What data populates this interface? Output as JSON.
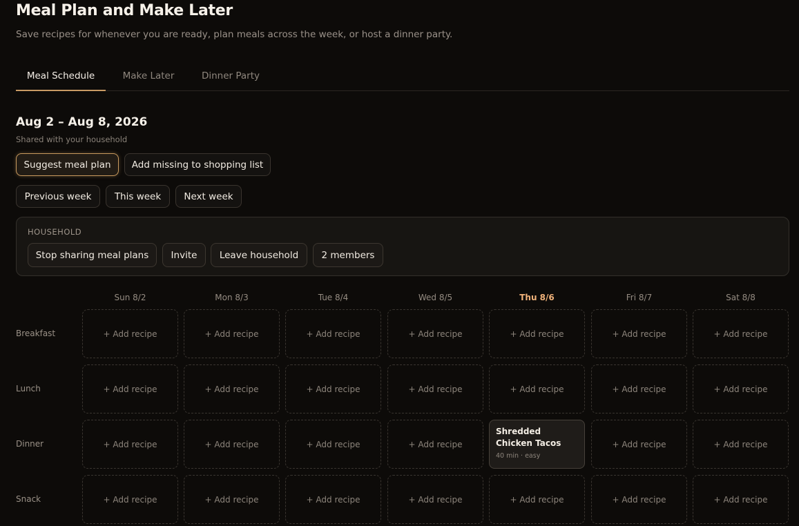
{
  "header": {
    "title": "Meal Plan and Make Later",
    "subtitle": "Save recipes for whenever you are ready, plan meals across the week, or host a dinner party."
  },
  "tabs": [
    {
      "label": "Meal Schedule",
      "active": true
    },
    {
      "label": "Make Later",
      "active": false
    },
    {
      "label": "Dinner Party",
      "active": false
    }
  ],
  "week": {
    "range": "Aug 2 – Aug 8, 2026",
    "shared_note": "Shared with your household"
  },
  "actions": {
    "suggest": "Suggest meal plan",
    "add_missing": "Add missing to shopping list",
    "previous": "Previous week",
    "this_week": "This week",
    "next": "Next week"
  },
  "household": {
    "label": "HOUSEHOLD",
    "stop_sharing": "Stop sharing meal plans",
    "invite": "Invite",
    "leave": "Leave household",
    "members": "2 members"
  },
  "days": [
    {
      "label": "Sun 8/2",
      "today": false
    },
    {
      "label": "Mon 8/3",
      "today": false
    },
    {
      "label": "Tue 8/4",
      "today": false
    },
    {
      "label": "Wed 8/5",
      "today": false
    },
    {
      "label": "Thu 8/6",
      "today": true
    },
    {
      "label": "Fri 8/7",
      "today": false
    },
    {
      "label": "Sat 8/8",
      "today": false
    }
  ],
  "meals": [
    "Breakfast",
    "Lunch",
    "Dinner",
    "Snack"
  ],
  "add_recipe_label": "+ Add recipe",
  "planned": [
    {
      "meal": 2,
      "day": 4,
      "name": "Shredded Chicken Tacos",
      "meta": "40 min · easy"
    }
  ],
  "colors": {
    "background": "#0d0b09",
    "accent": "#c99a64",
    "today": "#f0b27a"
  }
}
